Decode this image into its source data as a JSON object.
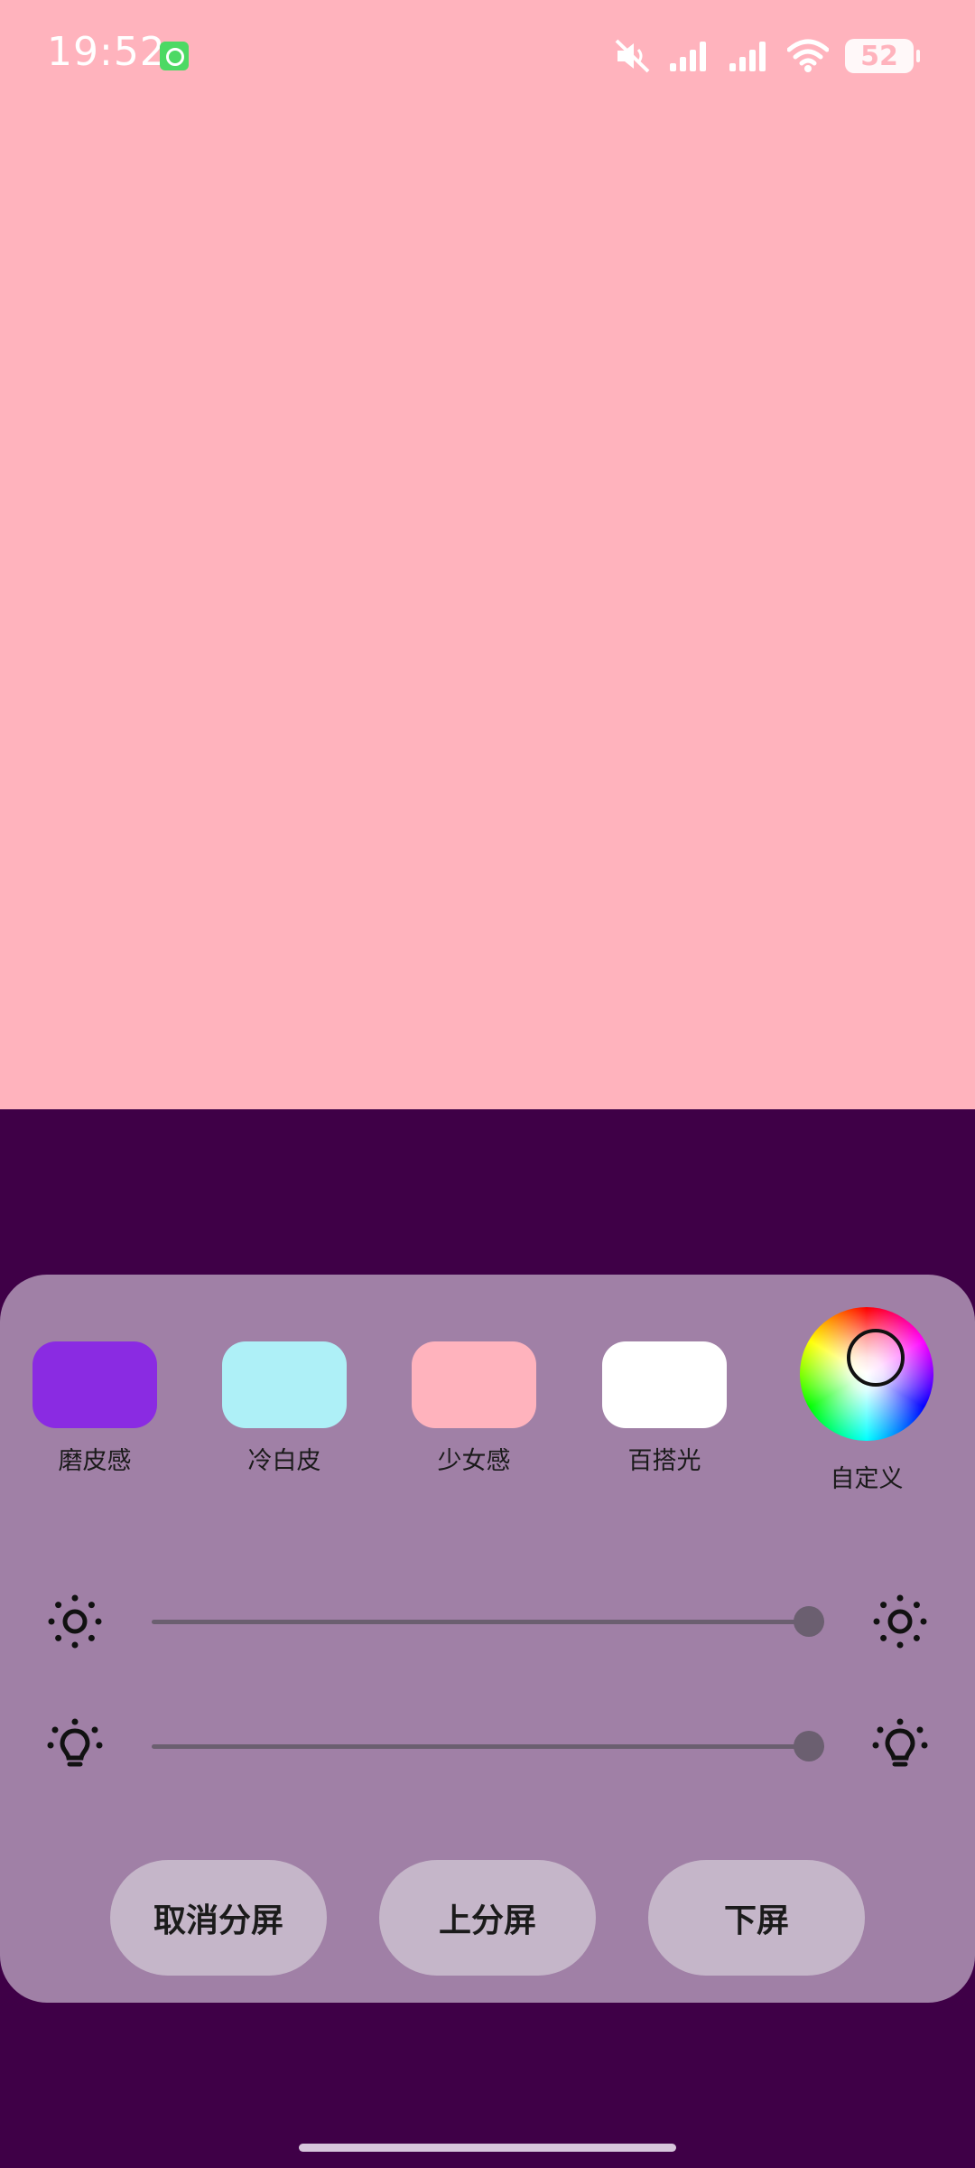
{
  "status_bar": {
    "time": "19:52",
    "battery": "52",
    "icons": [
      "app-notification-icon",
      "mute-icon",
      "signal-icon",
      "signal-icon",
      "wifi-icon",
      "battery-icon"
    ]
  },
  "light": {
    "color": "#ffb3bd"
  },
  "presets": [
    {
      "label": "磨皮感",
      "color": "#8a2be2"
    },
    {
      "label": "冷白皮",
      "color": "#aef0f7"
    },
    {
      "label": "少女感",
      "color": "#ffb3bd"
    },
    {
      "label": "百搭光",
      "color": "#ffffff"
    }
  ],
  "custom": {
    "label": "自定义"
  },
  "sliders": {
    "brightness": {
      "value": 1.0
    },
    "warmth": {
      "value": 1.0
    }
  },
  "buttons": {
    "cancel_split": "取消分屏",
    "top_split": "上分屏",
    "bottom_split": "下屏"
  }
}
